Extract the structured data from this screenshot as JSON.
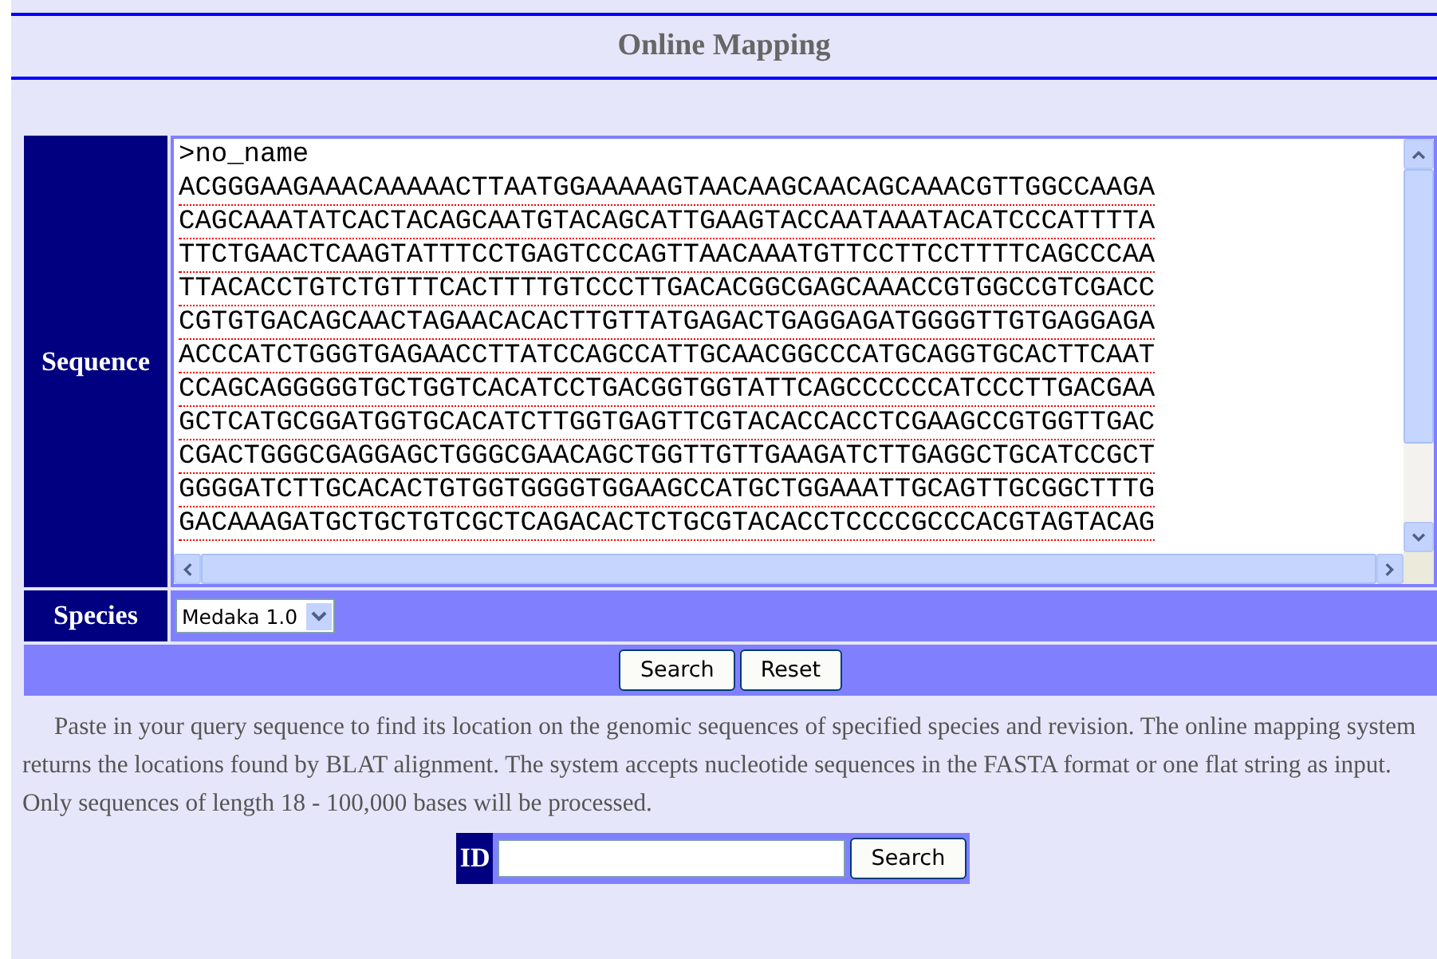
{
  "title": "Online Mapping",
  "sequence": {
    "label": "Sequence",
    "lines": [
      ">no_name",
      "ACGGGAAGAAACAAAAACTTAATGGAAAAAGTAACAAGCAACAGCAAACGTTGGCCAAGA",
      "CAGCAAATATCACTACAGCAATGTACAGCATTGAAGTACCAATAAATACATCCCATTTTA",
      "TTCTGAACTCAAGTATTTCCTGAGTCCCAGTTAACAAATGTTCCTTCCTTTTCAGCCCAA",
      "TTACACCTGTCTGTTTCACTTTTGTCCCTTGACACGGCGAGCAAACCGTGGCCGTCGACC",
      "CGTGTGACAGCAACTAGAACACACTTGTTATGAGACTGAGGAGATGGGGTTGTGAGGAGA",
      "ACCCATCTGGGTGAGAACCTTATCCAGCCATTGCAACGGCCCATGCAGGTGCACTTCAAT",
      "CCAGCAGGGGGTGCTGGTCACATCCTGACGGTGGTATTCAGCCCCCCATCCCTTGACGAA",
      "GCTCATGCGGATGGTGCACATCTTGGTGAGTTCGTACACCACCTCGAAGCCGTGGTTGAC",
      "CGACTGGGCGAGGAGCTGGGCGAACAGCTGGTTGTTGAAGATCTTGAGGCTGCATCCGCT",
      "GGGGATCTTGCACACTGTGGTGGGGTGGAAGCCATGCTGGAAATTGCAGTTGCGGCTTTG",
      "GACAAAGATGCTGCTGTCGCTCAGACACTCTGCGTACACCTCCCCGCCCACGTAGTACAG"
    ]
  },
  "species": {
    "label": "Species",
    "value": "Medaka 1.0"
  },
  "buttons": [
    "Search",
    "Reset"
  ],
  "description": "Paste in your query sequence to find its location on the genomic sequences of specified species and revision. The online mapping system returns the locations found by BLAT alignment. The system accepts nucleotide sequences in the FASTA format or one flat string as input. Only sequences of length 18 - 100,000 bases will be processed.",
  "id_search": {
    "label": "ID",
    "button": "Search"
  }
}
